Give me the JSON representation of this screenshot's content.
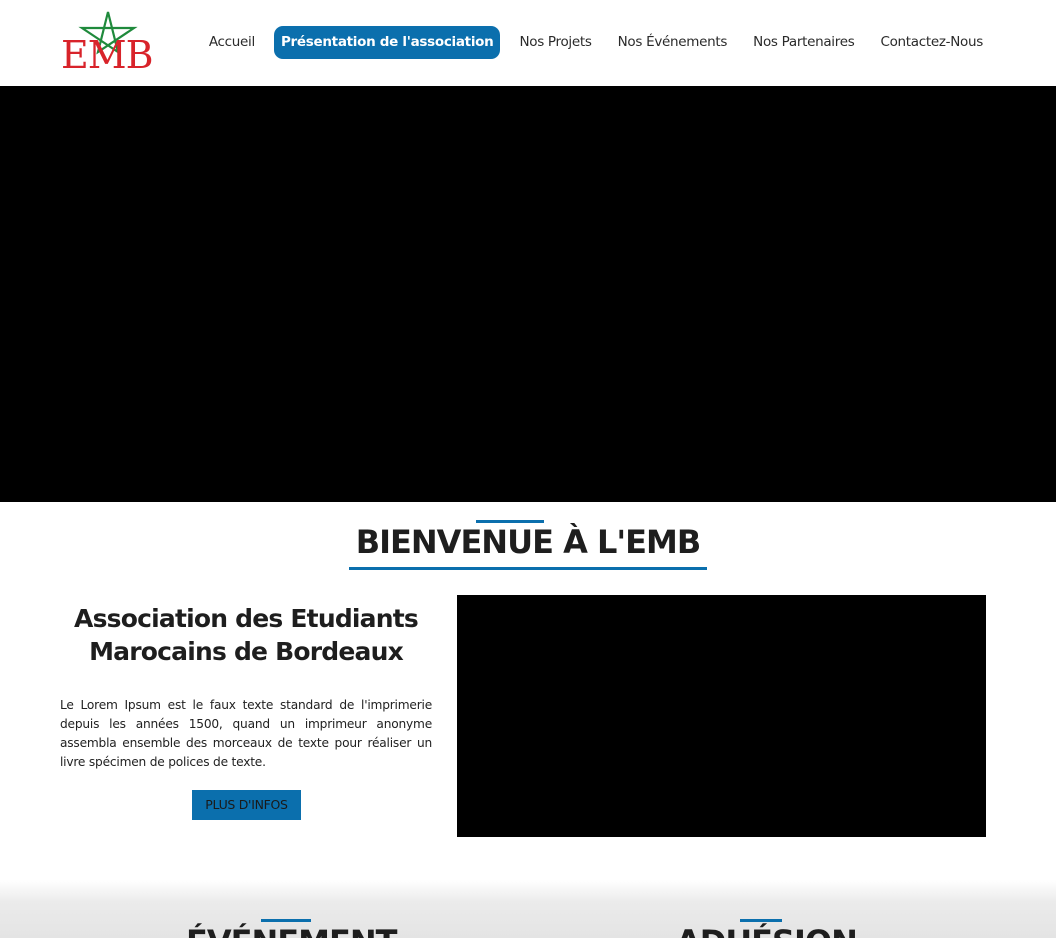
{
  "brand": {
    "logo_text": "EMB",
    "colors": {
      "red": "#d8232a",
      "green": "#1f8a3c",
      "blue": "#0b6fad"
    }
  },
  "nav": {
    "items": [
      {
        "label": "Accueil",
        "active": false
      },
      {
        "label": "Présentation de l'association",
        "active": true
      },
      {
        "label": "Nos Projets",
        "active": false
      },
      {
        "label": "Nos Événements",
        "active": false
      },
      {
        "label": "Nos Partenaires",
        "active": false
      },
      {
        "label": "Contactez-Nous",
        "active": false
      }
    ]
  },
  "welcome": {
    "title": "BIENVENUE À L'EMB"
  },
  "intro": {
    "title": "Association des Etudiants Marocains de Bordeaux",
    "text": "Le Lorem Ipsum est le faux texte standard de l'imprimerie depuis les années 1500, quand un imprimeur anonyme assembla ensemble des morceaux de texte pour réaliser un livre spécimen de polices de texte.",
    "button_label": "PLUS D'INFOS"
  },
  "sections": {
    "events_title": "ÉVÉNEMENT",
    "membership_title": "ADHÉSION"
  }
}
